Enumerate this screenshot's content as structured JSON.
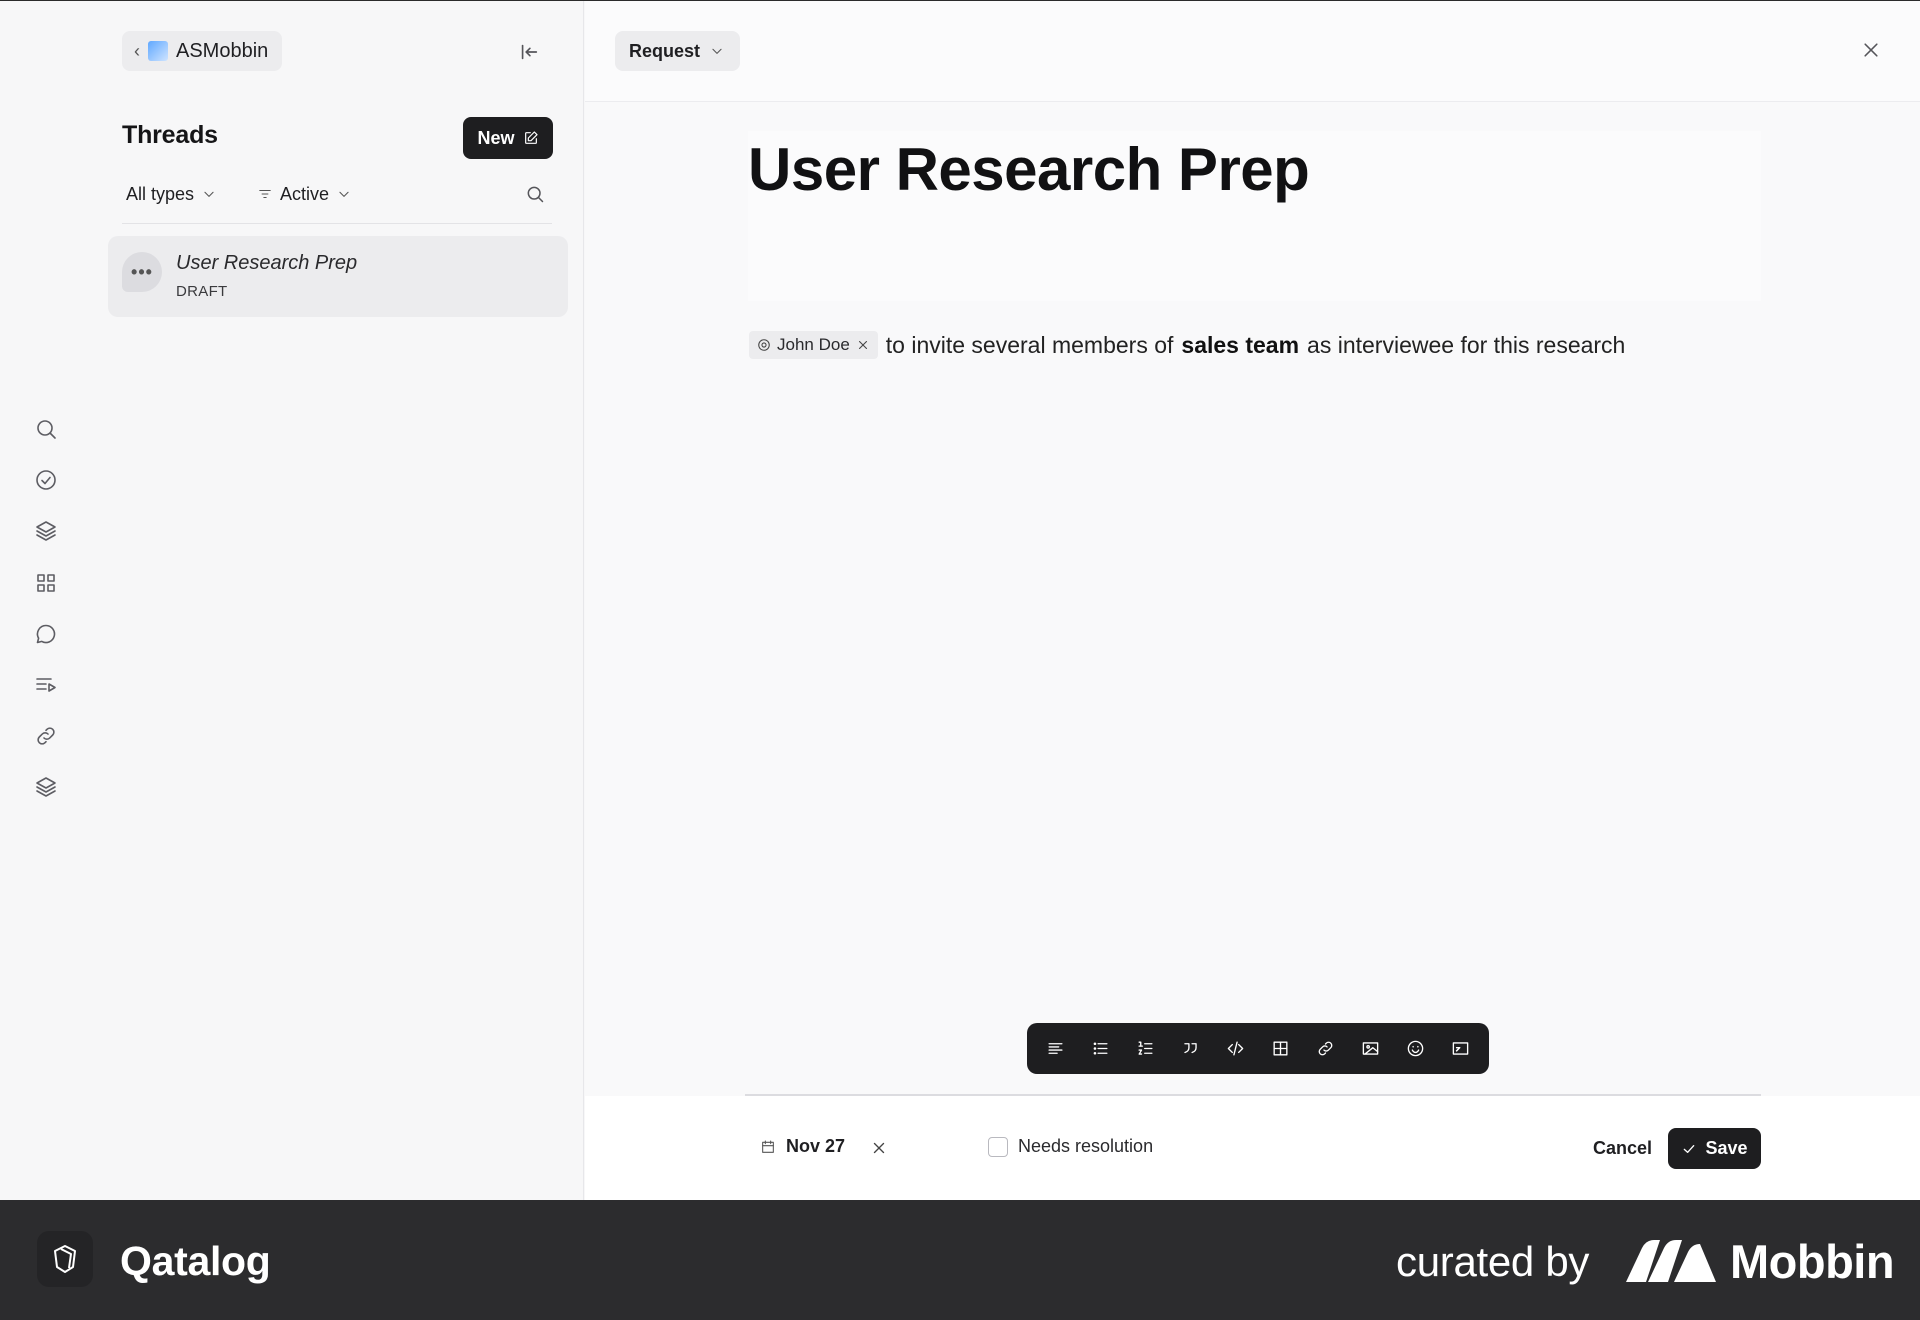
{
  "sidebar": {
    "workspace_name": "ASMobbin",
    "threads_title": "Threads",
    "new_button_label": "New",
    "filter_types_label": "All types",
    "filter_status_label": "Active",
    "threads": [
      {
        "title": "User Research Prep",
        "status": "DRAFT",
        "avatar_glyph": "•••"
      }
    ]
  },
  "rail_icons": [
    "search-icon",
    "check-circle-icon",
    "layers-icon",
    "grid-icon",
    "chat-icon",
    "list-play-icon",
    "link-icon",
    "stack-icon"
  ],
  "main": {
    "type_selector_label": "Request",
    "title": "User Research Prep",
    "body": {
      "mention": "John Doe",
      "text_before_bold": "to invite several members of",
      "bold_text": "sales team",
      "text_after_bold": "as interviewee for this research"
    },
    "toolbar_icons": [
      "align-left-icon",
      "bullet-list-icon",
      "numbered-list-icon",
      "quote-icon",
      "code-icon",
      "table-icon",
      "link-icon",
      "image-icon",
      "emoji-icon",
      "embed-icon"
    ],
    "footer": {
      "due_date": "Nov 27",
      "needs_resolution_label": "Needs resolution",
      "cancel_label": "Cancel",
      "save_label": "Save"
    }
  },
  "branding": {
    "app_name": "Qatalog",
    "curated_by": "curated by",
    "brand": "Mobbin"
  },
  "colors": {
    "dark_button": "#1e1e20",
    "brand_bar": "#2c2c2e",
    "background": "#f7f7f8"
  }
}
